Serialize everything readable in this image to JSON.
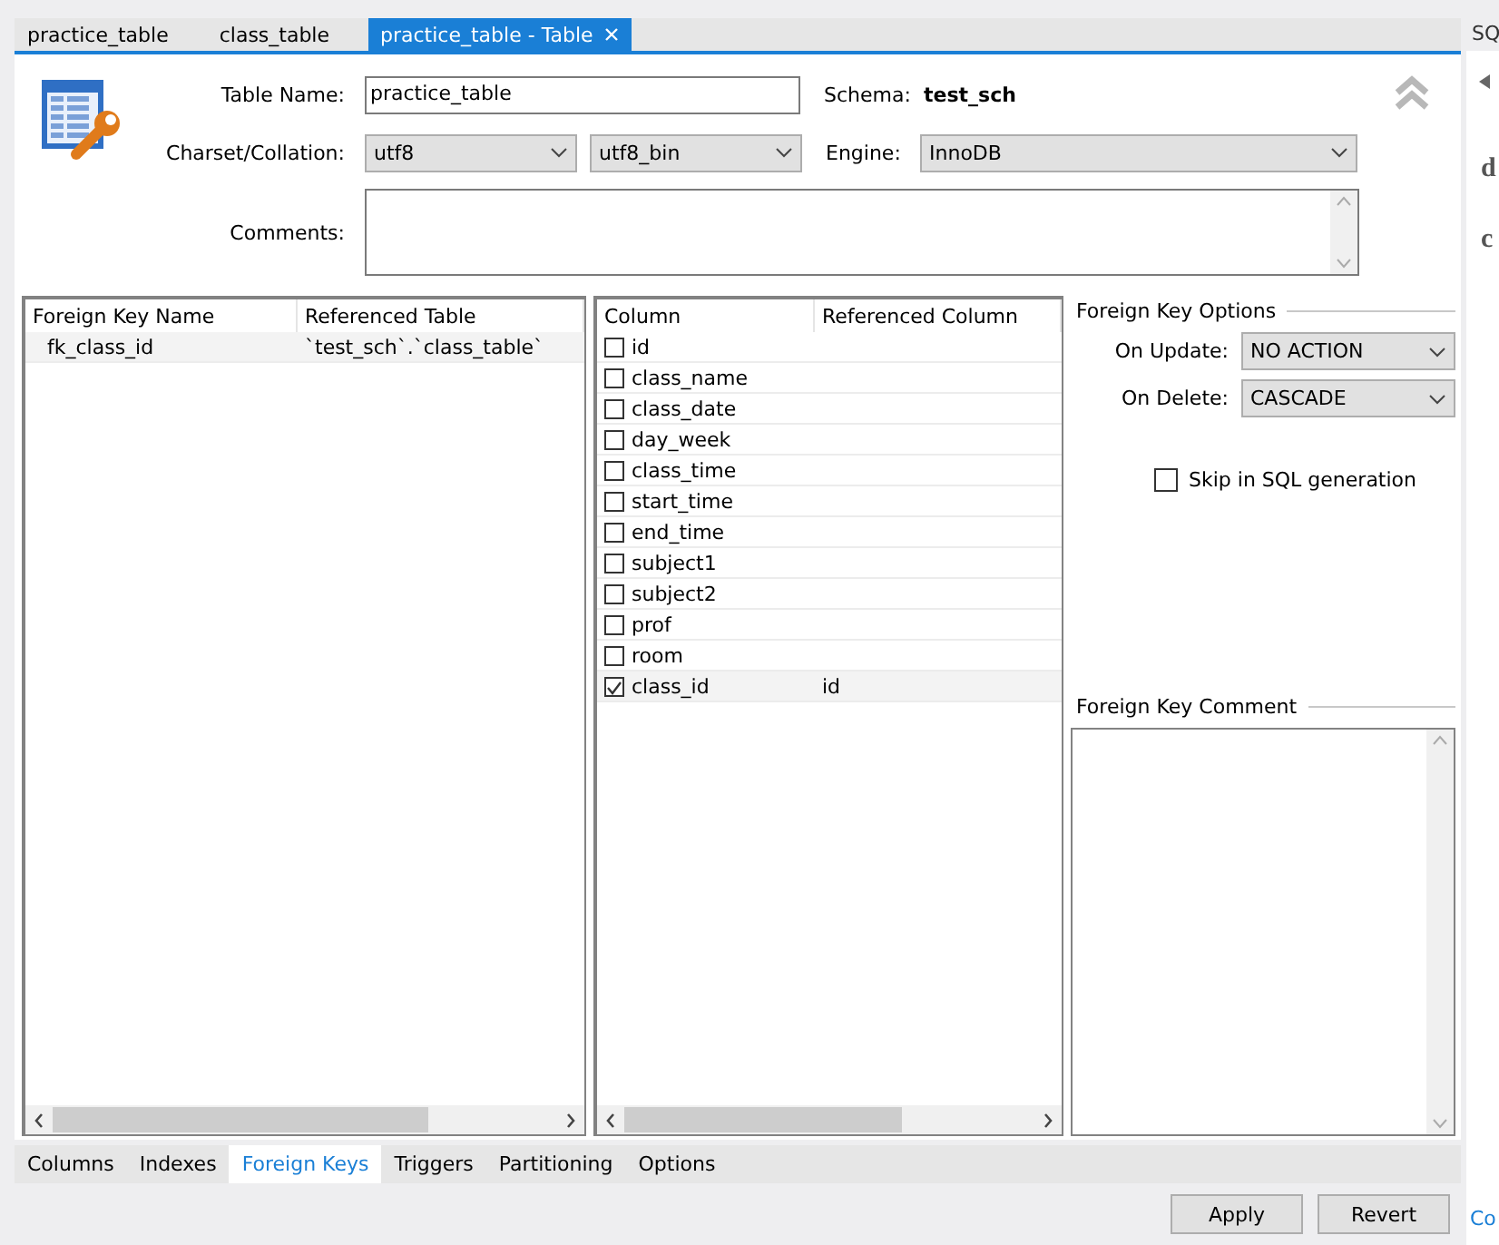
{
  "doc_tabs": [
    {
      "label": "practice_table",
      "selected": false
    },
    {
      "label": "class_table",
      "selected": false
    },
    {
      "label": "practice_table - Table",
      "selected": true
    }
  ],
  "header": {
    "table_name_label": "Table Name:",
    "table_name": "practice_table",
    "schema_label": "Schema:",
    "schema": "test_sch",
    "charset_label": "Charset/Collation:",
    "charset": "utf8",
    "collation": "utf8_bin",
    "engine_label": "Engine:",
    "engine": "InnoDB",
    "comments_label": "Comments:"
  },
  "foreign_keys": {
    "columns": [
      "Foreign Key Name",
      "Referenced Table"
    ],
    "rows": [
      {
        "cells": [
          "fk_class_id",
          "`test_sch`.`class_table`"
        ],
        "selected": true
      }
    ]
  },
  "column_map": {
    "columns": [
      "Column",
      "Referenced Column"
    ],
    "rows": [
      {
        "column": "id",
        "checked": false,
        "selected": false
      },
      {
        "column": "class_name",
        "checked": false,
        "selected": false
      },
      {
        "column": "class_date",
        "checked": false,
        "selected": false
      },
      {
        "column": "day_week",
        "checked": false,
        "selected": false
      },
      {
        "column": "class_time",
        "checked": false,
        "selected": false
      },
      {
        "column": "start_time",
        "checked": false,
        "selected": false
      },
      {
        "column": "end_time",
        "checked": false,
        "selected": false
      },
      {
        "column": "subject1",
        "checked": false,
        "selected": false
      },
      {
        "column": "subject2",
        "checked": false,
        "selected": false
      },
      {
        "column": "prof",
        "checked": false,
        "selected": false
      },
      {
        "column": "room",
        "checked": false,
        "selected": false
      },
      {
        "column": "class_id",
        "checked": true,
        "selected": true,
        "referenced": "id"
      }
    ]
  },
  "options": {
    "title": "Foreign Key Options",
    "on_update_label": "On Update:",
    "on_update": "NO ACTION",
    "on_delete_label": "On Delete:",
    "on_delete": "CASCADE",
    "skip": {
      "label": "Skip in SQL generation",
      "checked": false
    },
    "comment_title": "Foreign Key Comment"
  },
  "editor_tabs": [
    {
      "label": "Columns",
      "selected": false
    },
    {
      "label": "Indexes",
      "selected": false
    },
    {
      "label": "Foreign Keys",
      "selected": true
    },
    {
      "label": "Triggers",
      "selected": false
    },
    {
      "label": "Partitioning",
      "selected": false
    },
    {
      "label": "Options",
      "selected": false
    }
  ],
  "buttons": [
    "Apply",
    "Revert"
  ],
  "side_panel": {
    "tab": "SQ",
    "texts": [
      "d",
      "c"
    ],
    "link": "Co"
  }
}
